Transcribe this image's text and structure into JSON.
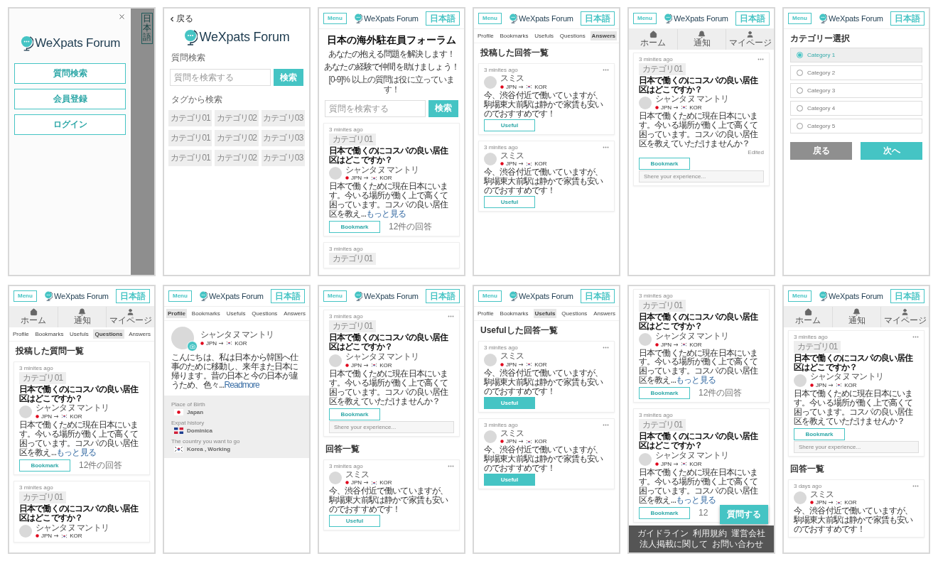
{
  "screens": [
    {
      "blocks": [
        {
          "kind": "drawer",
          "logo": "WeXpats Forum",
          "buttons": [
            "質問検索",
            "会員登録",
            "ログイン"
          ],
          "lang": "日本語"
        }
      ]
    },
    {
      "blocks": [
        {
          "kind": "back",
          "label": "戻る"
        },
        {
          "kind": "big_logo",
          "logo": "WeXpats Forum"
        },
        {
          "kind": "label",
          "text": "質問検索"
        },
        {
          "kind": "search",
          "placeholder": "質問を検索する",
          "button": "検索"
        },
        {
          "kind": "label",
          "text": "タグから検索"
        },
        {
          "kind": "tags",
          "items": [
            "カテゴリ01",
            "カテゴリ02",
            "カテゴリ03",
            "カテゴリ01",
            "カテゴリ02",
            "カテゴリ03",
            "カテゴリ01",
            "カテゴリ02",
            "カテゴリ03"
          ]
        }
      ]
    },
    {
      "blocks": [
        {
          "kind": "header",
          "menu": "Menu",
          "logo": "WeXpats Forum",
          "lang": "日本語"
        },
        {
          "kind": "hero",
          "title": "日本の海外駐在員フォーラム",
          "subtitle": [
            "あなたの抱える問題を解決します！",
            "あなたの経験で仲間を助けましょう！"
          ],
          "note": "[0-9]% 以上の質問は役に立っています！"
        },
        {
          "kind": "search",
          "placeholder": "質問を検索する",
          "button": "検索"
        },
        {
          "kind": "question",
          "dots": false,
          "time": "3 minites ago",
          "tag": "カテゴリ01",
          "title": "日本で働くのにコスパの良い居住区はどこですか？",
          "author": "シャンタヌ マントリ",
          "from": "JPN",
          "to": "KOR",
          "body": "日本で働くために現在日本にいます。今いる場所が働く上で高くて困っています。コスパの良い居住区を教え...",
          "more": "もっと見る",
          "bookmark": "Bookmark",
          "answers": "12件の回答"
        },
        {
          "kind": "question",
          "dots": false,
          "time": "3 minites ago",
          "tag": "カテゴリ01"
        }
      ]
    },
    {
      "blocks": [
        {
          "kind": "header",
          "menu": "Menu",
          "logo": "WeXpats Forum",
          "lang": "日本語"
        },
        {
          "kind": "tabs",
          "items": [
            {
              "label": "Profile",
              "selected": false
            },
            {
              "label": "Bookmarks",
              "selected": false
            },
            {
              "label": "Usefuls",
              "selected": false
            },
            {
              "label": "Questions",
              "selected": false
            },
            {
              "label": "Answers",
              "selected": true
            }
          ]
        },
        {
          "kind": "heading",
          "text": "投稿した回答一覧"
        },
        {
          "kind": "answer",
          "time": "3 minites ago",
          "author": "スミス",
          "from": "JPN",
          "to": "KOR",
          "body": "今、渋谷付近で働いていますが、駒場東大前駅は静かで家賃も安いのでおすすめです！",
          "useful": {
            "label": "Useful",
            "selected": false
          }
        },
        {
          "kind": "answer",
          "time": "3 minites ago",
          "author": "スミス",
          "from": "JPN",
          "to": "KOR",
          "body": "今、渋谷付近で働いていますが、駒場東大前駅は静かで家賃も安いのでおすすめです！",
          "useful": {
            "label": "Useful",
            "selected": false
          }
        }
      ]
    },
    {
      "blocks": [
        {
          "kind": "header",
          "menu": "Menu",
          "logo": "WeXpats Forum",
          "lang": "日本語"
        },
        {
          "kind": "nav",
          "items": [
            "ホーム",
            "通知",
            "マイページ"
          ]
        },
        {
          "kind": "question",
          "dots": true,
          "time": "3 minites ago",
          "tag": "カテゴリ01",
          "title": "日本で働くのにコスパの良い居住区はどこですか？",
          "author": "シャンタヌ マントリ",
          "from": "JPN",
          "to": "KOR",
          "body": "日本で働くために現在日本にいます。今いる場所が働く上で高くて困っています。コスパの良い居住区を教えていただけませんか？",
          "edited": "Edited",
          "bookmark": "Bookmark",
          "placeholder": "Shere your experience..."
        }
      ]
    },
    {
      "blocks": [
        {
          "kind": "header",
          "menu": "Menu",
          "logo": "WeXpats Forum",
          "lang": "日本語"
        },
        {
          "kind": "heading",
          "text": "カテゴリー選択"
        },
        {
          "kind": "radios",
          "items": [
            {
              "label": "Category 1",
              "selected": true
            },
            {
              "label": "Category 2",
              "selected": false
            },
            {
              "label": "Category 3",
              "selected": false
            },
            {
              "label": "Category 4",
              "selected": false
            },
            {
              "label": "Category 5",
              "selected": false
            }
          ]
        },
        {
          "kind": "actions",
          "buttons": [
            {
              "label": "戻る",
              "kind": "secondary"
            },
            {
              "label": "次へ",
              "kind": "primary"
            }
          ]
        }
      ]
    },
    {
      "blocks": [
        {
          "kind": "header",
          "menu": "Menu",
          "logo": "WeXpats Forum",
          "lang": "日本語"
        },
        {
          "kind": "nav",
          "items": [
            "ホーム",
            "通知",
            "マイページ"
          ]
        },
        {
          "kind": "tabs",
          "items": [
            {
              "label": "Profile",
              "selected": false
            },
            {
              "label": "Bookmarks",
              "selected": false
            },
            {
              "label": "Usefuls",
              "selected": false
            },
            {
              "label": "Questions",
              "selected": true
            },
            {
              "label": "Answers",
              "selected": false
            }
          ]
        },
        {
          "kind": "heading",
          "text": "投稿した質問一覧"
        },
        {
          "kind": "question",
          "dots": false,
          "time": "3 minites ago",
          "tag": "カテゴリ01",
          "title": "日本で働くのにコスパの良い居住区はどこですか？",
          "author": "シャンタヌ マントリ",
          "from": "JPN",
          "to": "KOR",
          "body": "日本で働くために現在日本にいます。今いる場所が働く上で高くて困っています。コスパの良い居住区を教え...",
          "more": "もっと見る",
          "bookmark": "Bookmark",
          "answers": "12件の回答"
        },
        {
          "kind": "question",
          "dots": false,
          "time": "3 minites ago",
          "tag": "カテゴリ01",
          "title": "日本で働くのにコスパの良い居住区はどこですか？",
          "author": "シャンタヌ マントリ",
          "from": "JPN",
          "to": "KOR"
        }
      ]
    },
    {
      "blocks": [
        {
          "kind": "header",
          "menu": "Menu",
          "logo": "WeXpats Forum",
          "lang": "日本語"
        },
        {
          "kind": "tabs",
          "items": [
            {
              "label": "Profile",
              "selected": true
            },
            {
              "label": "Bookmarks",
              "selected": false
            },
            {
              "label": "Usefuls",
              "selected": false
            },
            {
              "label": "Questions",
              "selected": false
            },
            {
              "label": "Answers",
              "selected": false
            }
          ]
        },
        {
          "kind": "profile",
          "name": "シャンタヌ マントリ",
          "from": "JPN",
          "to": "KOR",
          "bio": "こんにちは、私は日本から韓国へ仕事のために移動し、来年また日本に帰ります。昔の日本と今の日本が違うため、色々...",
          "more": "Readmore"
        },
        {
          "kind": "details",
          "items": [
            {
              "label": "Place of Birth",
              "value": "Japan"
            },
            {
              "label": "Expat history",
              "value": "Dominica"
            },
            {
              "label": "The country you want to go",
              "value": "Korea , Working"
            }
          ]
        }
      ]
    },
    {
      "blocks": [
        {
          "kind": "header",
          "menu": "Menu",
          "logo": "WeXpats Forum",
          "lang": "日本語"
        },
        {
          "kind": "question",
          "dots": true,
          "time": "3 minites ago",
          "tag": "カテゴリ01",
          "title": "日本で働くのにコスパの良い居住区はどこですか？",
          "author": "シャンタヌ マントリ",
          "from": "JPN",
          "to": "KOR",
          "body": "日本で働くために現在日本にいます。今いる場所が働く上で高くて困っています。コスパの良い居住区を教えていただけませんか？",
          "bookmark": "Bookmark",
          "placeholder": "Shere your experience..."
        },
        {
          "kind": "heading",
          "text": "回答一覧"
        },
        {
          "kind": "answer",
          "time": "3 minites ago",
          "author": "スミス",
          "from": "JPN",
          "to": "KOR",
          "body": "今、渋谷付近で働いていますが、駒場東大前駅は静かで家賃も安いのでおすすめです！",
          "useful": {
            "label": "Useful",
            "selected": false
          }
        }
      ]
    },
    {
      "blocks": [
        {
          "kind": "header",
          "menu": "Menu",
          "logo": "WeXpats Forum",
          "lang": "日本語"
        },
        {
          "kind": "tabs",
          "items": [
            {
              "label": "Profile",
              "selected": false
            },
            {
              "label": "Bookmarks",
              "selected": false
            },
            {
              "label": "Usefuls",
              "selected": true
            },
            {
              "label": "Questions",
              "selected": false
            },
            {
              "label": "Answers",
              "selected": false
            }
          ]
        },
        {
          "kind": "heading",
          "text": "Usefulした回答一覧"
        },
        {
          "kind": "answer",
          "time": "3 minites ago",
          "author": "スミス",
          "from": "JPN",
          "to": "KOR",
          "body": "今、渋谷付近で働いていますが、駒場東大前駅は静かで家賃も安いのでおすすめです！",
          "useful": {
            "label": "Useful",
            "selected": true
          }
        },
        {
          "kind": "answer",
          "time": "3 minites ago",
          "author": "スミス",
          "from": "JPN",
          "to": "KOR",
          "body": "今、渋谷付近で働いていますが、駒場東大前駅は静かで家賃も安いのでおすすめです！",
          "useful": {
            "label": "Useful",
            "selected": true
          }
        }
      ]
    },
    {
      "blocks": [
        {
          "kind": "question",
          "dots": false,
          "time": "3 minites ago",
          "tag": "カテゴリ01",
          "title": "日本で働くのにコスパの良い居住区はどこですか？",
          "author": "シャンタヌ マントリ",
          "from": "JPN",
          "to": "KOR",
          "body": "日本で働くために現在日本にいます。今いる場所が働く上で高くて困っています。コスパの良い居住区を教え...",
          "more": "もっと見る",
          "bookmark": "Bookmark",
          "answers": "12件の回答"
        },
        {
          "kind": "question",
          "dots": false,
          "time": "3 minites ago",
          "tag": "カテゴリ01",
          "title": "日本で働くのにコスパの良い居住区はどこですか？",
          "author": "シャンタヌ マントリ",
          "from": "JPN",
          "to": "KOR",
          "body": "日本で働くために現在日本にいます。今いる場所が働く上で高くて困っています。コスパの良い居住区を教え...",
          "more": "もっと見る",
          "bookmark": "Bookmark",
          "answers": "12"
        },
        {
          "kind": "fab",
          "label": "質問する"
        },
        {
          "kind": "footer",
          "links": [
            "ガイドライン",
            "利用規約",
            "運営会社",
            "法人掲載に関して",
            "お問い合わせ"
          ]
        }
      ]
    },
    {
      "blocks": [
        {
          "kind": "header",
          "menu": "Menu",
          "logo": "WeXpats Forum",
          "lang": "日本語"
        },
        {
          "kind": "nav",
          "items": [
            "ホーム",
            "通知",
            "マイページ"
          ]
        },
        {
          "kind": "question",
          "dots": true,
          "time": "3 minites ago",
          "tag": "カテゴリ01",
          "title": "日本で働くのにコスパの良い居住区はどこですか？",
          "author": "シャンタヌ マントリ",
          "from": "JPN",
          "to": "KOR",
          "body": "日本で働くために現在日本にいます。今いる場所が働く上で高くて困っています。コスパの良い居住区を教えていただけませんか？",
          "bookmark": "Bookmark",
          "placeholder": "Shere your experience..."
        },
        {
          "kind": "heading",
          "text": "回答一覧"
        },
        {
          "kind": "answer",
          "time": "3 days ago",
          "author": "スミス",
          "from": "JPN",
          "to": "KOR",
          "body": "今、渋谷付近で働いていますが、駒場東大前駅は静かで家賃も安いのでおすすめです！"
        }
      ]
    }
  ]
}
